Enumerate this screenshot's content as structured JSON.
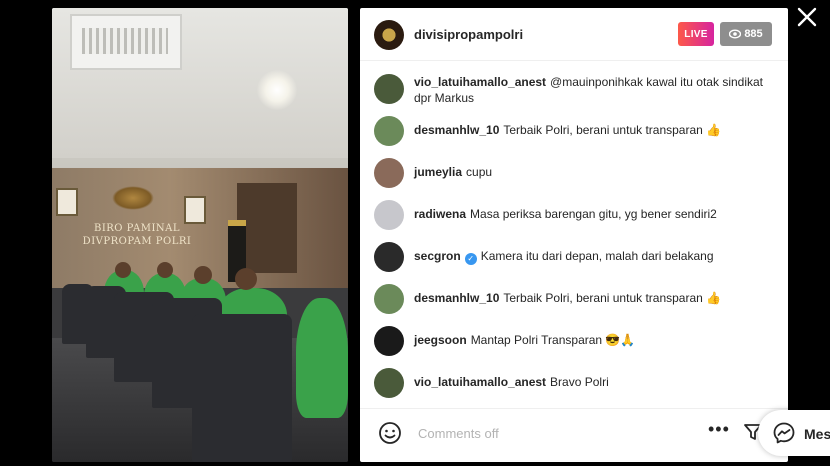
{
  "stream": {
    "sign_line1": "BIRO PAMINAL",
    "sign_line2": "DIVPROPAM POLRI"
  },
  "header": {
    "username": "divisipropampolri",
    "live_badge": "LIVE",
    "viewer_count": "885"
  },
  "comments": [
    {
      "user": "vio_latuihamallo_anest",
      "text": "@mauinponihkak kawal itu otak sindikat dpr Markus",
      "avatar_color": "#4a5a3a",
      "verified": false
    },
    {
      "user": "desmanhlw_10",
      "text": "Terbaik Polri, berani untuk transparan 👍",
      "avatar_color": "#6b8a5a",
      "verified": false
    },
    {
      "user": "jumeylia",
      "text": "cupu",
      "avatar_color": "#8a6a5a",
      "verified": false
    },
    {
      "user": "radiwena",
      "text": "Masa periksa barengan gitu, yg bener sendiri2",
      "avatar_color": "#c7c7cc",
      "verified": false
    },
    {
      "user": "secgron",
      "text": "Kamera itu dari depan, malah dari belakang",
      "avatar_color": "#2a2a2a",
      "verified": true
    },
    {
      "user": "desmanhlw_10",
      "text": "Terbaik Polri, berani untuk transparan 👍",
      "avatar_color": "#6b8a5a",
      "verified": false
    },
    {
      "user": "jeegsoon",
      "text": "Mantap Polri Transparan 😎🙏",
      "avatar_color": "#1a1a1a",
      "verified": false
    },
    {
      "user": "vio_latuihamallo_anest",
      "text": "Bravo Polri",
      "avatar_color": "#4a5a3a",
      "verified": false
    }
  ],
  "footer": {
    "comments_off_placeholder": "Comments off",
    "more_label": "•••"
  },
  "messages": {
    "label": "Mes"
  },
  "icons": {
    "close": "close-icon",
    "eye": "eye-icon",
    "emoji": "emoji-icon",
    "filter": "filter-icon",
    "messenger": "messenger-icon"
  }
}
